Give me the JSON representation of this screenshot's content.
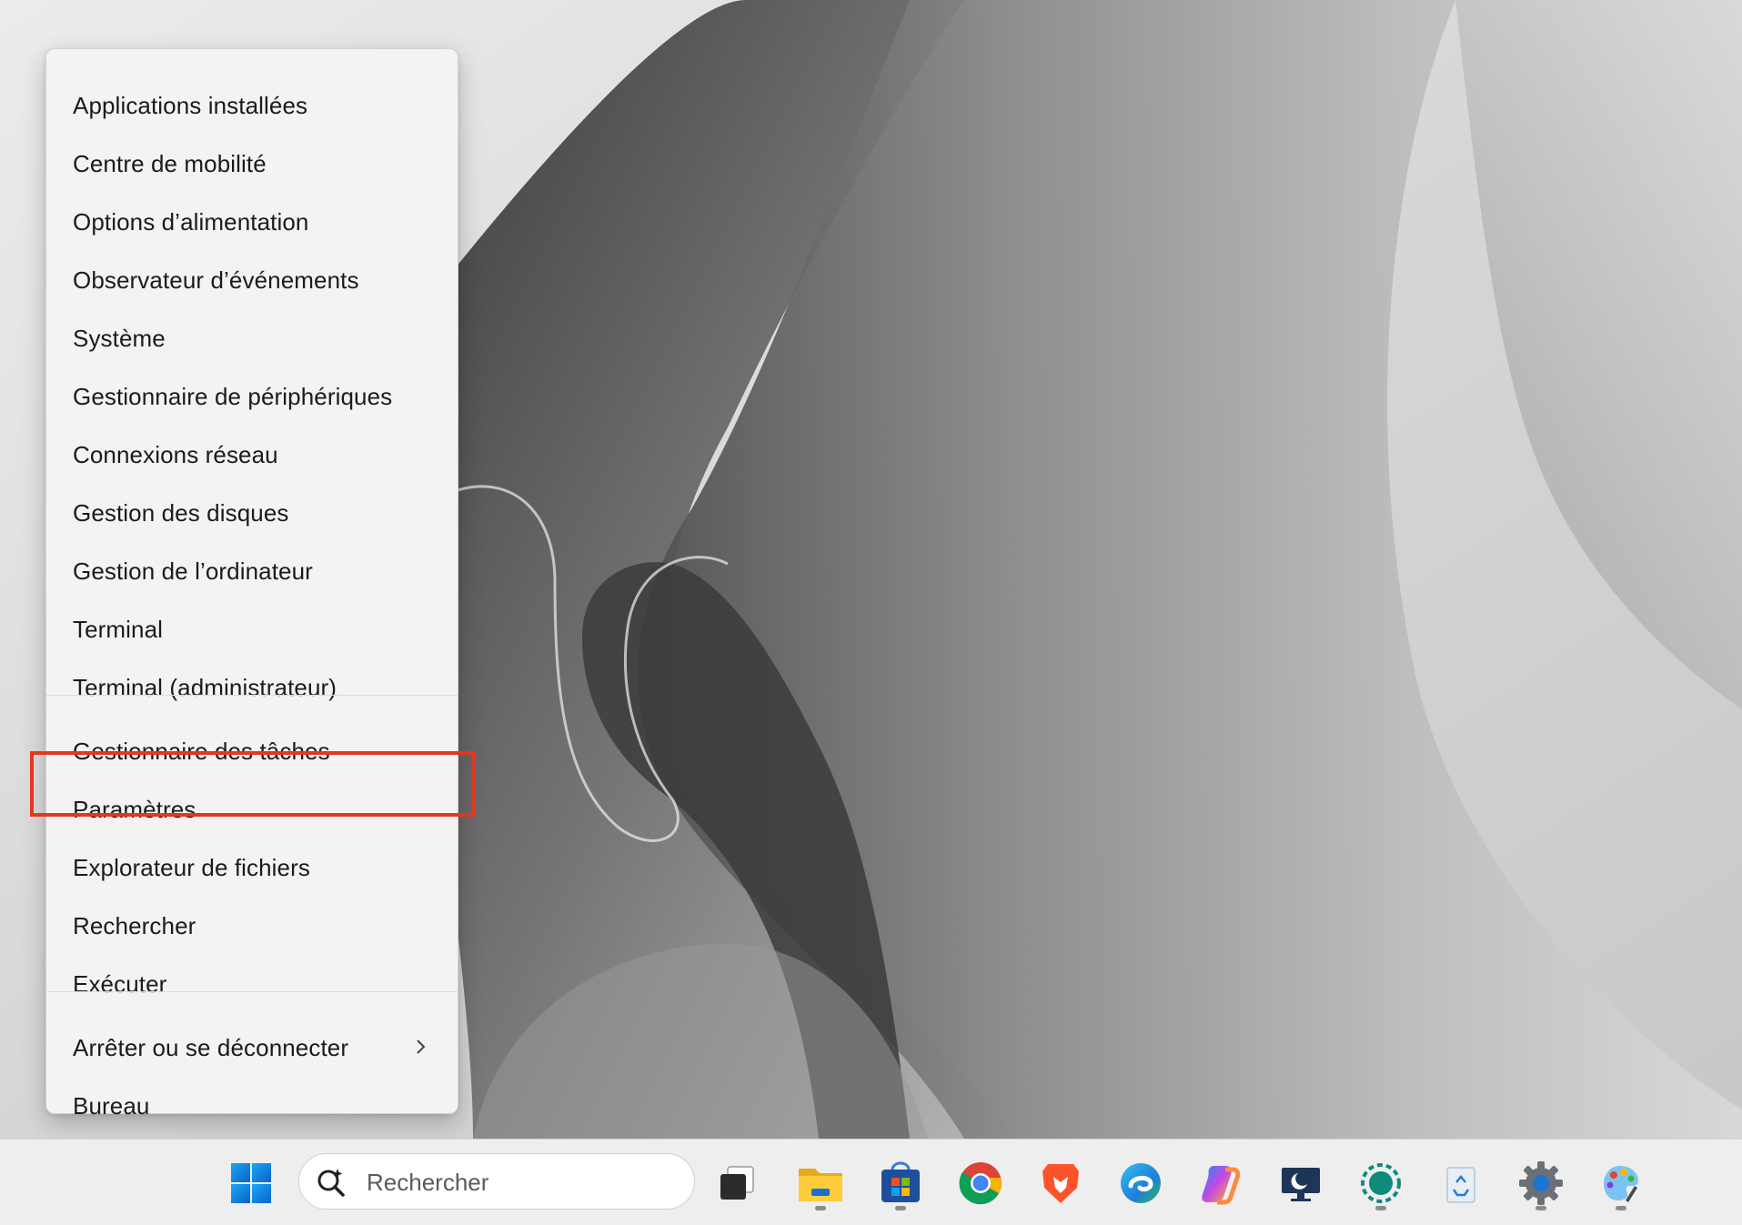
{
  "context_menu": {
    "items": [
      {
        "label": "Applications installées"
      },
      {
        "label": "Centre de mobilité"
      },
      {
        "label": "Options d’alimentation"
      },
      {
        "label": "Observateur d’événements"
      },
      {
        "label": "Système"
      },
      {
        "label": "Gestionnaire de périphériques"
      },
      {
        "label": "Connexions réseau"
      },
      {
        "label": "Gestion des disques"
      },
      {
        "label": "Gestion de l’ordinateur"
      },
      {
        "label": "Terminal"
      },
      {
        "label": "Terminal (administrateur)"
      },
      {
        "label": "Gestionnaire des tâches"
      },
      {
        "label": "Paramètres",
        "highlighted": true
      },
      {
        "label": "Explorateur de fichiers"
      },
      {
        "label": "Rechercher"
      },
      {
        "label": "Exécuter"
      },
      {
        "label": "Arrêter ou se déconnecter",
        "icon": "chevron-right-icon"
      },
      {
        "label": "Bureau"
      }
    ],
    "highlight_color": "#e3371f"
  },
  "taskbar": {
    "search": {
      "placeholder": "Rechercher"
    },
    "apps": [
      {
        "name": "start-icon",
        "running": false
      },
      {
        "name": "task-view-icon",
        "running": false
      },
      {
        "name": "file-explorer-icon",
        "running": true
      },
      {
        "name": "microsoft-store-icon",
        "running": true
      },
      {
        "name": "chrome-icon",
        "running": false
      },
      {
        "name": "brave-icon",
        "running": false
      },
      {
        "name": "edge-icon",
        "running": false
      },
      {
        "name": "copilot-icon",
        "running": false
      },
      {
        "name": "monitor-icon",
        "running": false
      },
      {
        "name": "screen-recorder-icon",
        "running": true
      },
      {
        "name": "recycle-bin-icon",
        "running": false
      },
      {
        "name": "settings-gear-icon",
        "running": true
      },
      {
        "name": "paint-icon",
        "running": true
      }
    ]
  }
}
